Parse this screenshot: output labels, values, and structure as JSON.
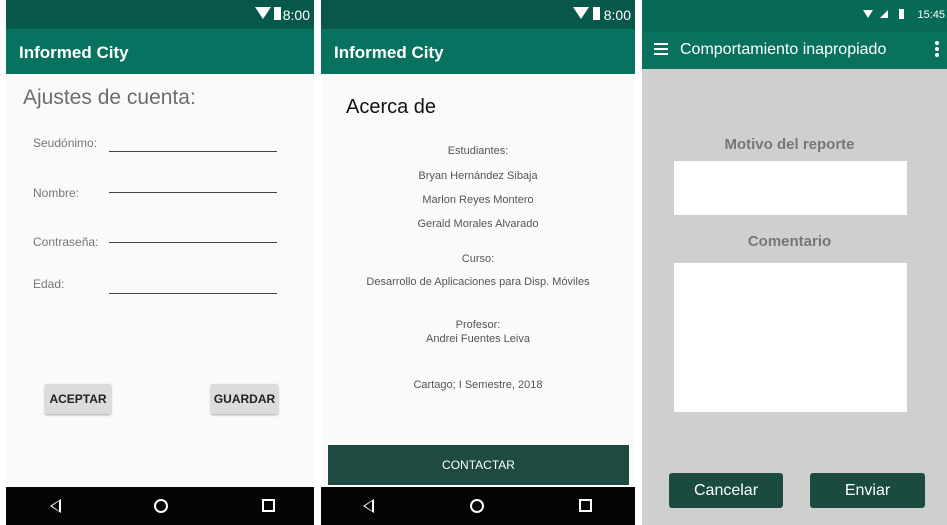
{
  "panel1": {
    "status_time": "8:00",
    "app_title": "Informed City",
    "heading": "Ajustes de cuenta:",
    "fields": [
      {
        "label": "Seudónimo:"
      },
      {
        "label": "Nombre:"
      },
      {
        "label": "Contraseña:"
      },
      {
        "label": "Edad:"
      }
    ],
    "buttons": {
      "accept": "ACEPTAR",
      "save": "GUARDAR"
    }
  },
  "panel2": {
    "status_time": "8:00",
    "app_title": "Informed City",
    "heading": "Acerca de",
    "students_label": "Estudiantes:",
    "students": [
      "Bryan Hernández Sibaja",
      "Marlon Reyes Montero",
      "Gerald Morales Alvarado"
    ],
    "course_label": "Curso:",
    "course": "Desarrollo de Aplicaciones para Disp. Móviles",
    "professor_label": "Profesor:",
    "professor": "Andrei Fuentes Leiva",
    "place_date": "Cartago; I Semestre, 2018",
    "contact_button": "CONTACTAR"
  },
  "panel3": {
    "status_time": "15:45",
    "toolbar_title": "Comportamiento inapropiado",
    "reason_label": "Motivo del reporte",
    "comment_label": "Comentario",
    "cancel_button": "Cancelar",
    "send_button": "Enviar"
  },
  "icons": {
    "status": [
      "wifi-icon",
      "battery-icon"
    ],
    "nav": [
      "back-icon",
      "home-icon",
      "recents-icon"
    ],
    "toolbar": [
      "menu-icon",
      "more-options-icon"
    ]
  },
  "colors": {
    "status_bar": "#07574b",
    "app_bar": "#07725f",
    "dark_button": "#1b4a40",
    "nav_bar": "#050505",
    "report_background": "#cfcfcf"
  }
}
